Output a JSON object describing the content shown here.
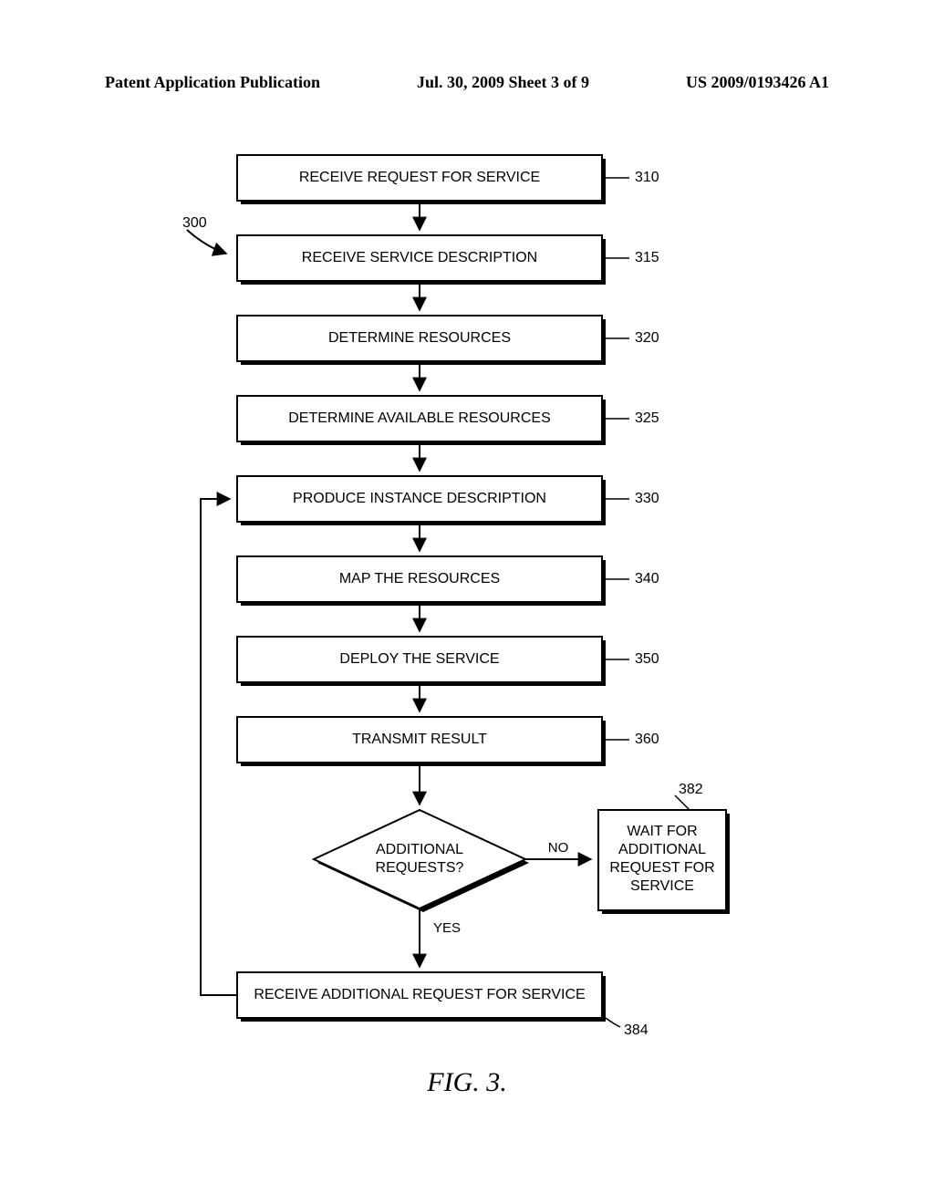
{
  "header": {
    "left": "Patent Application Publication",
    "center": "Jul. 30, 2009  Sheet 3 of 9",
    "right": "US 2009/0193426 A1"
  },
  "figure_label": "FIG. 3.",
  "overall_ref": "300",
  "blocks": {
    "b310": {
      "text": "RECEIVE REQUEST FOR SERVICE",
      "ref": "310"
    },
    "b315": {
      "text": "RECEIVE SERVICE DESCRIPTION",
      "ref": "315"
    },
    "b320": {
      "text": "DETERMINE RESOURCES",
      "ref": "320"
    },
    "b325": {
      "text": "DETERMINE AVAILABLE RESOURCES",
      "ref": "325"
    },
    "b330": {
      "text": "PRODUCE INSTANCE DESCRIPTION",
      "ref": "330"
    },
    "b340": {
      "text": "MAP THE RESOURCES",
      "ref": "340"
    },
    "b350": {
      "text": "DEPLOY THE SERVICE",
      "ref": "350"
    },
    "b360": {
      "text": "TRANSMIT RESULT",
      "ref": "360"
    },
    "b382": {
      "line1": "WAIT FOR",
      "line2": "ADDITIONAL",
      "line3": "REQUEST FOR",
      "line4": "SERVICE",
      "ref": "382"
    },
    "b384": {
      "text": "RECEIVE ADDITIONAL REQUEST FOR SERVICE",
      "ref": "384"
    }
  },
  "decision": {
    "line1": "ADDITIONAL",
    "line2": "REQUESTS?",
    "yes": "YES",
    "no": "NO"
  }
}
